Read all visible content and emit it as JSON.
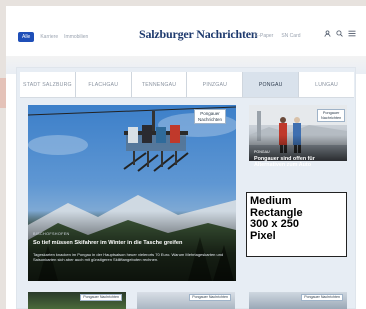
{
  "header": {
    "nav_active": "Alle",
    "nav_links": [
      "Karriere",
      "Immobilien"
    ],
    "logo": "Salzburger Nachrichten",
    "right_links": [
      "E-Paper",
      "SN Card"
    ]
  },
  "tabs": [
    {
      "label": "STADT SALZBURG",
      "active": false
    },
    {
      "label": "FLACHGAU",
      "active": false
    },
    {
      "label": "TENNENGAU",
      "active": false
    },
    {
      "label": "PINZGAU",
      "active": false
    },
    {
      "label": "PONGAU",
      "active": true
    },
    {
      "label": "LUNGAU",
      "active": false
    }
  ],
  "main_story": {
    "tag_line1": "Pongauer",
    "tag_line2": "Nachrichten",
    "kicker": "BISCHOFSHOFEN",
    "title": "So tief müssen Skifahrer im Winter in die Tasche greifen",
    "teaser": "Tageskarten knacken im Pongau in der Hauptsaison heuer vielerorts 70 Euro. Warum Mehrtageskarten und Saisonkarten sich aber auch mit günstigeren Skiliftangeboten rechnen."
  },
  "side_story": {
    "tag_line1": "Pongauer",
    "tag_line2": "Nachrichten",
    "kicker": "PONGAU",
    "title": "Pongauer sind offen für Alternativen zum Auto"
  },
  "ad": {
    "lines": [
      "Medium",
      "Rectangle",
      "300 x 250",
      "Pixel"
    ]
  },
  "thumbs": [
    {
      "tag": "Pongauer Nachrichten"
    },
    {
      "tag": "Pongauer Nachrichten"
    },
    {
      "tag": "Pongauer Nachrichten"
    }
  ],
  "colors": {
    "brand": "#1e3a6e",
    "pill": "#1f4fb8",
    "panel": "#e7edf4",
    "active_tab": "#d9e2ec"
  },
  "icons": [
    "user-icon",
    "search-icon",
    "menu-icon"
  ]
}
